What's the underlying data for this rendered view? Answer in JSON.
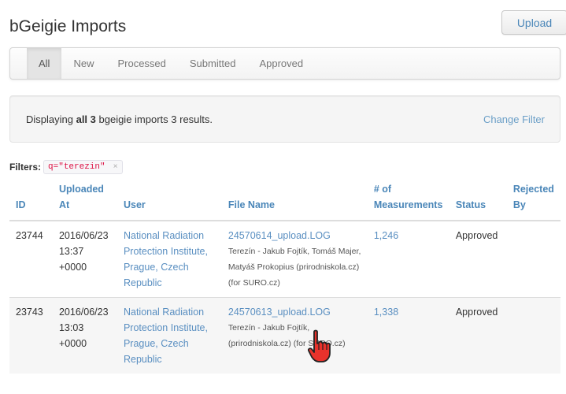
{
  "page": {
    "title": "bGeigie Imports",
    "upload_label": "Upload"
  },
  "tabs": [
    {
      "label": "All",
      "active": true
    },
    {
      "label": "New"
    },
    {
      "label": "Processed"
    },
    {
      "label": "Submitted"
    },
    {
      "label": "Approved"
    }
  ],
  "summary": {
    "prefix": "Displaying ",
    "bold": "all 3",
    "suffix": " bgeigie imports 3 results.",
    "change_filter": "Change Filter"
  },
  "filters": {
    "label": "Filters:",
    "chip": "q=\"terezin\"",
    "remove": "×"
  },
  "table": {
    "headers": {
      "id": "ID",
      "uploaded": "Uploaded At",
      "user": "User",
      "file": "File Name",
      "measurements": "# of Measurements",
      "status": "Status",
      "rejected": "Rejected By"
    },
    "rows": [
      {
        "id": "23744",
        "uploaded": "2016/06/23 13:37 +0000",
        "user": "National Radiation Protection Institute, Prague, Czech Republic",
        "file": "24570614_upload.LOG",
        "note": "Terezín -  Jakub Fojtík, Tomáš Majer, Matyáš Prokopius (prirodniskola.cz) (for SURO.cz)",
        "measurements": "1,246",
        "status": "Approved",
        "rejected": ""
      },
      {
        "id": "23743",
        "uploaded": "2016/06/23 13:03 +0000",
        "user": "National Radiation Protection Institute, Prague, Czech Republic",
        "file": "24570613_upload.LOG",
        "note": "Terezín -  Jakub Fojtík, (prirodniskola.cz) (for SURO.cz)",
        "measurements": "1,338",
        "status": "Approved",
        "rejected": ""
      }
    ]
  },
  "cursor": {
    "icon": "hand-pointer-icon"
  }
}
